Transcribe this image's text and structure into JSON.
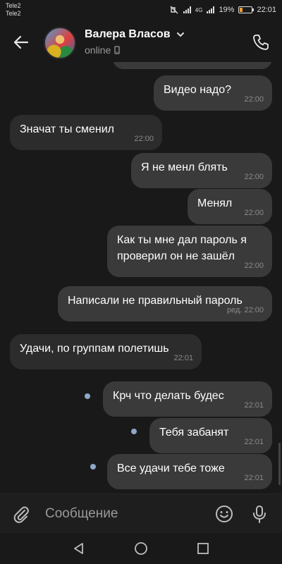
{
  "status_bar": {
    "carrier1": "Tele2",
    "carrier2": "Tele2",
    "network": "4G",
    "battery": "19%",
    "time": "22:01"
  },
  "header": {
    "back_icon": "arrow-left-icon",
    "contact_name": "Валера Власов",
    "status": "online",
    "status_icon": "mobile-icon",
    "call_icon": "phone-icon"
  },
  "messages": [
    {
      "side": "right",
      "text": "Видео надо?",
      "time": "22:00",
      "unread": false
    },
    {
      "side": "left",
      "text": "Значат ты сменил",
      "time": "22:00",
      "unread": false
    },
    {
      "side": "right",
      "text": "Я не менл блять",
      "time": "22:00",
      "unread": false
    },
    {
      "side": "right",
      "text": "Менял",
      "time": "22:00",
      "unread": false
    },
    {
      "side": "right",
      "text": "Как ты мне дал пароль я\nпроверил он не зашёл",
      "time": "22:00",
      "unread": false
    },
    {
      "side": "right",
      "text": "Написали не правильный пароль",
      "time": "ред. 22:00",
      "unread": false
    },
    {
      "side": "left",
      "text": "Удачи,  по группам  полетишь",
      "time": "22:01",
      "unread": false
    },
    {
      "side": "right",
      "text": "Крч что делать будес",
      "time": "22:01",
      "unread": true
    },
    {
      "side": "right",
      "text": "Тебя забанят",
      "time": "22:01",
      "unread": true
    },
    {
      "side": "right",
      "text": "Все удачи тебе тоже",
      "time": "22:01",
      "unread": true
    }
  ],
  "composer": {
    "placeholder": "Сообщение",
    "attach_icon": "paperclip-icon",
    "emoji_icon": "smile-icon",
    "mic_icon": "microphone-icon"
  },
  "nav": {
    "back_icon": "triangle-back-icon",
    "home_icon": "circle-home-icon",
    "recents_icon": "square-recents-icon"
  },
  "colors": {
    "background": "#191919",
    "bubble_outgoing": "#3a3a3a",
    "bubble_incoming": "#2c2c2c",
    "unread_dot": "#8fa8c8"
  }
}
